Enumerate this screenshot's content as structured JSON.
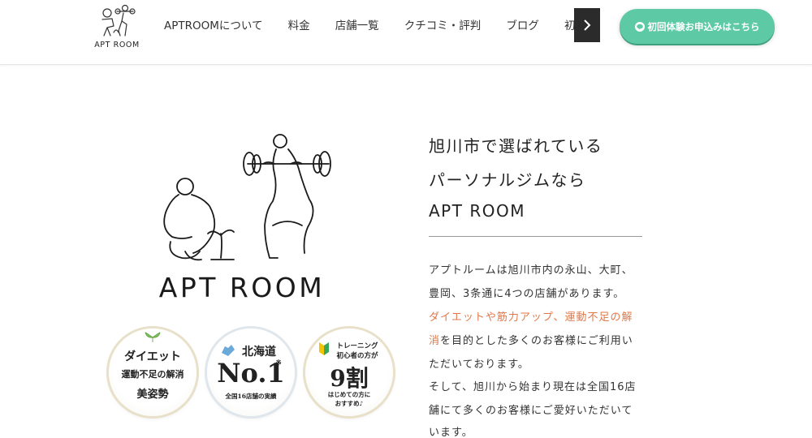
{
  "header": {
    "logo_text": "APT ROOM",
    "nav": [
      "APTROOMについて",
      "料金",
      "店舗一覧",
      "クチコミ・評判",
      "ブログ",
      "初回体験"
    ],
    "cta_label": "初回体験お申込みはこちら"
  },
  "hero": {
    "logo_text": "APT ROOM",
    "badges": {
      "b1": [
        "ダイエット",
        "運動不足の解消",
        "美姿勢"
      ],
      "b2": {
        "region": "北海道",
        "rank": "No.1",
        "mark": "※",
        "note": "全国16店舗の実績"
      },
      "b3": {
        "top1": "トレーニング",
        "top2": "初心者の方が",
        "big": "9割",
        "bottom1": "はじめての方に",
        "bottom2": "おすすめ♪"
      }
    }
  },
  "content": {
    "heading_lines": [
      "旭川市で選ばれている",
      "パーソナルジムなら",
      "APT ROOM"
    ],
    "para1_line1": "アプトルームは旭川市内の永山、大町、",
    "para1_line2": "豊岡、3条通に4つの店舗があります。",
    "para1_highlight_a": "ダイエットや筋力アップ、運動不足の解",
    "para1_highlight_b": "消",
    "para1_line4_rest": "を目的とした多くのお客様にご利用い",
    "para1_line5": "ただいております。",
    "para2_line1": "そして、旭川から始まり現在は全国16店",
    "para2_line2": "舗にて多くのお客様にご愛好いただいて",
    "para2_line3": "います。"
  },
  "colors": {
    "cta": "#5ecaa5",
    "highlight": "#e0784a",
    "nav_next": "#2b2b2b"
  }
}
